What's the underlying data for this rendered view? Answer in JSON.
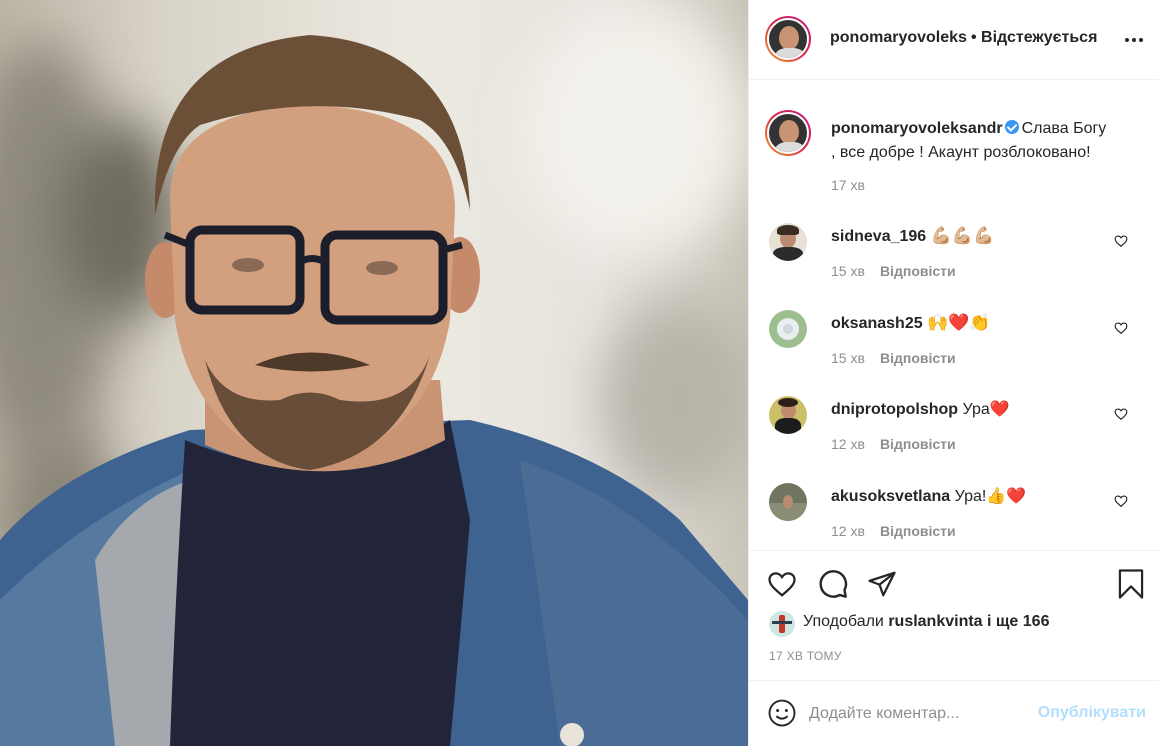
{
  "post": {
    "author": "ponomaryovoleksandr",
    "author_header": "ponomaryovoleks",
    "follow_status": "• Відстежується",
    "caption_line1": "Слава Богу",
    "caption_line2": ", все добре ! Акаунт розблоковано!",
    "caption_time": "17 хв"
  },
  "comments": [
    {
      "user": "sidneva_196",
      "text": "💪🏼💪🏼💪🏼",
      "time": "15 хв",
      "reply": "Відповісти"
    },
    {
      "user": "oksanash25",
      "text": "🙌❤️👏",
      "time": "15 хв",
      "reply": "Відповісти"
    },
    {
      "user": "dniprotopolshop",
      "text": "Ура❤️",
      "time": "12 хв",
      "reply": "Відповісти"
    },
    {
      "user": "akusoksvetlana",
      "text": "Ура!👍❤️",
      "time": "12 хв",
      "reply": "Відповісти"
    }
  ],
  "likes": {
    "prefix": "Уподобали",
    "user": "ruslankvinta",
    "suffix": "і ще 166"
  },
  "posted_ago": "17 ХВ ТОМУ",
  "add_comment": {
    "placeholder": "Додайте коментар...",
    "publish": "Опублікувати"
  },
  "icons": {
    "like": "heart-icon",
    "comment": "comment-icon",
    "share": "share-icon",
    "save": "bookmark-icon",
    "more": "more-options-icon",
    "emoji": "emoji-icon"
  },
  "colors": {
    "verified": "#3897f0",
    "publish_disabled": "#b2dffc",
    "muted": "#8e8e8e",
    "text": "#262626"
  }
}
